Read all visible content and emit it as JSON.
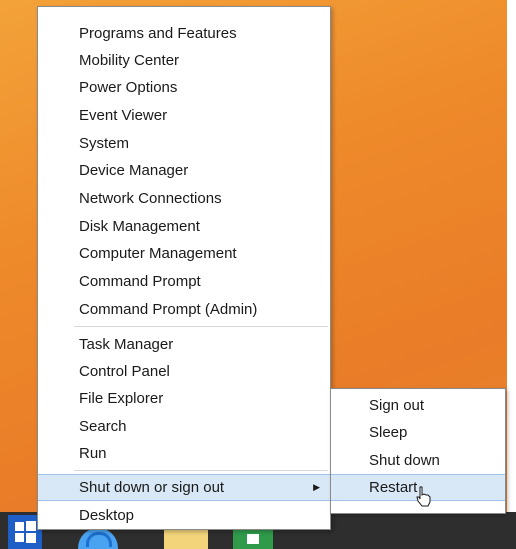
{
  "context_menu": {
    "items": [
      {
        "label": "Programs and Features"
      },
      {
        "label": "Mobility Center"
      },
      {
        "label": "Power Options"
      },
      {
        "label": "Event Viewer"
      },
      {
        "label": "System"
      },
      {
        "label": "Device Manager"
      },
      {
        "label": "Network Connections"
      },
      {
        "label": "Disk Management"
      },
      {
        "label": "Computer Management"
      },
      {
        "label": "Command Prompt"
      },
      {
        "label": "Command Prompt (Admin)"
      },
      {
        "label": "Task Manager"
      },
      {
        "label": "Control Panel"
      },
      {
        "label": "File Explorer"
      },
      {
        "label": "Search"
      },
      {
        "label": "Run"
      },
      {
        "label": "Shut down or sign out"
      },
      {
        "label": "Desktop"
      }
    ],
    "hovered_item": "Shut down or sign out"
  },
  "submenu": {
    "items": [
      {
        "label": "Sign out"
      },
      {
        "label": "Sleep"
      },
      {
        "label": "Shut down"
      },
      {
        "label": "Restart"
      }
    ],
    "hovered_item": "Restart"
  },
  "icons": {
    "submenu_arrow": "chevron-right-icon",
    "start": "windows-start-icon",
    "cursor": "hand-pointer-icon",
    "taskbar_apps": [
      "internet-explorer-icon",
      "file-explorer-icon",
      "store-icon"
    ]
  },
  "colors": {
    "wallpaper": "#ee8a2a",
    "hover_highlight": "#d9e8f7",
    "hover_border": "#9fc3ea",
    "start_button": "#1d5fc7",
    "taskbar": "#2e2e2e"
  }
}
